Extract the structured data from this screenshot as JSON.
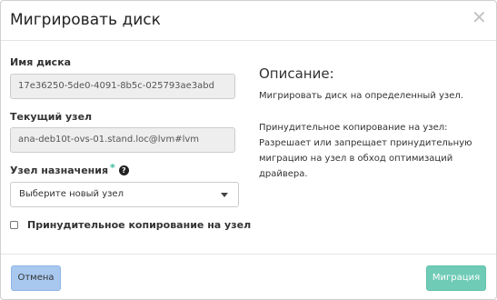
{
  "dialog": {
    "title": "Мигрировать диск",
    "close_symbol": "✕"
  },
  "form": {
    "disk_name": {
      "label": "Имя диска",
      "value": "17e36250-5de0-4091-8b5c-025793ae3abd"
    },
    "current_host": {
      "label": "Текущий узел",
      "value": "ana-deb10t-ovs-01.stand.loc@lvm#lvm"
    },
    "dest_host": {
      "label": "Узел назначения",
      "required_marker": "*",
      "help_symbol": "?",
      "selected": "Выберите новый узел"
    },
    "force_copy": {
      "label": "Принудительное копирование на узел",
      "checked": false
    }
  },
  "description": {
    "title": "Описание:",
    "summary": "Мигрировать диск на определенный узел.",
    "detail": "Принудительное копирование на узел: Разрешает или запрещает принудительную миграцию на узел в обход оптимизаций драйвера."
  },
  "footer": {
    "cancel_label": "Отмена",
    "submit_label": "Миграция"
  },
  "colors": {
    "accent": "#3cba9f",
    "cancel_bg": "#a8c8ef",
    "submit_bg": "#6fcbb6"
  },
  "icons": {
    "close": "close-icon",
    "help": "question-circle-icon",
    "dropdown": "caret-down-icon"
  }
}
